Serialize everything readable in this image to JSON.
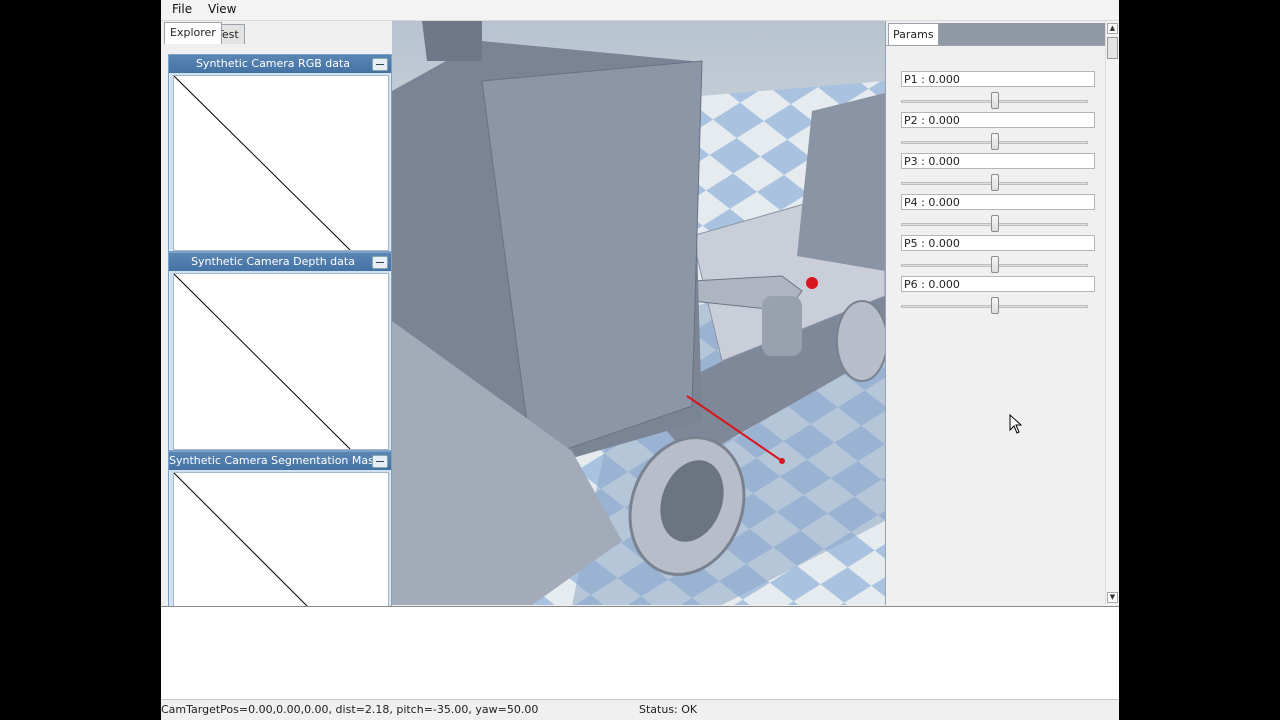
{
  "menubar": {
    "file_label": "File",
    "view_label": "View"
  },
  "explorer": {
    "tabs": [
      {
        "label": "Explorer"
      },
      {
        "label": "Test"
      }
    ],
    "camera_windows": [
      {
        "title": "Synthetic Camera RGB data"
      },
      {
        "title": "Synthetic Camera Depth data"
      },
      {
        "title": "Synthetic Camera Segmentation Mask"
      }
    ]
  },
  "params": {
    "tab_label": "Params",
    "sliders": [
      {
        "label": "P1 : 0.000",
        "value": 0.5
      },
      {
        "label": "P2 : 0.000",
        "value": 0.5
      },
      {
        "label": "P3 : 0.000",
        "value": 0.5
      },
      {
        "label": "P4 : 0.000",
        "value": 0.5
      },
      {
        "label": "P5 : 0.000",
        "value": 0.5
      },
      {
        "label": "P6 : 0.000",
        "value": 0.5
      }
    ]
  },
  "statusbar": {
    "camera_text": "CamTargetPos=0.00,0.00,0.00, dist=2.18, pitch=-35.00, yaw=50.00",
    "status_text": "Status: OK"
  },
  "colors": {
    "title_bar": "#4a78a8",
    "floor_light": "#e6ebf0",
    "floor_blue": "#a9c2e0",
    "robot_body": "#8a94a4",
    "target_red": "#d8161e"
  },
  "icons": {
    "window_button": "minimize-icon",
    "scroll_up": "arrow-up-icon",
    "scroll_down": "arrow-down-icon",
    "cursor": "mouse-pointer-icon"
  }
}
